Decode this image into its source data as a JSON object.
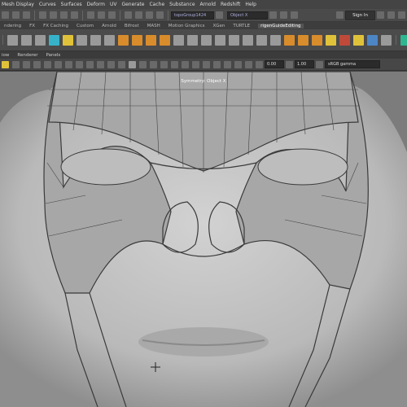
{
  "menubar": [
    "Mesh Display",
    "Curves",
    "Surfaces",
    "Deform",
    "UV",
    "Generate",
    "Cache",
    "Substance",
    "Arnold",
    "Redshift",
    "Help"
  ],
  "statusline": {
    "field1": "topoGroup1424",
    "field2": "Object X",
    "signin": "Sign In"
  },
  "shelf_tabs": [
    "ndering",
    "FX",
    "FX Caching",
    "Custom",
    "Arnold",
    "Bifrost",
    "MASH",
    "Motion Graphics",
    "XGen",
    "TURTLE",
    "rigenGuideEditing"
  ],
  "active_shelf_tab": 10,
  "panel_menu": [
    "iow",
    "Renderer",
    "Panels"
  ],
  "panel_toolbar": {
    "value1": "0.00",
    "value2": "1.00",
    "colorspace": "sRGB gamma"
  },
  "viewport": {
    "label": "Symmetry: Object X"
  },
  "colors": {
    "viewport_bg": "#7c7c7c",
    "wire": "#111111",
    "accent_orange": "#d98c2b",
    "accent_teal": "#2fb58f"
  }
}
